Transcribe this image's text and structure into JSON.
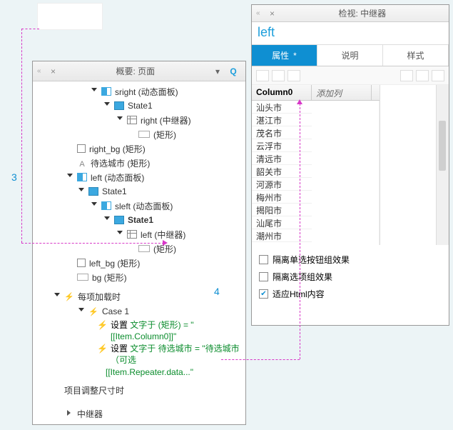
{
  "outline": {
    "title": "概要: 页面",
    "nodes": {
      "sright": "sright (动态面板)",
      "state1a": "State1",
      "right_rep": "right (中继器)",
      "rect1": "(矩形)",
      "right_bg": "right_bg (矩形)",
      "pending_city": "待选城市 (矩形)",
      "left_panel": "left (动态面板)",
      "state1b": "State1",
      "sleft": "sleft (动态面板)",
      "state1c": "State1",
      "left_rep": "left (中继器)",
      "rect2": "(矩形)",
      "left_bg": "left_bg (矩形)",
      "bg": "bg (矩形)"
    },
    "events": {
      "onItemLoad": "每项加载时",
      "case1": "Case 1",
      "action1_prefix": "设置 ",
      "action1_green": "文字于 (矩形) = \"[[Item.Column0]]\"",
      "action2_prefix": "设置 ",
      "action2_green": "文字于 待选城市 = \"待选城市（可选",
      "action2_cont": "[[Item.Repeater.data...\"",
      "sizeAdjust": "项目调整尺寸时"
    },
    "footer": "中继器"
  },
  "inspector": {
    "title": "检视: 中继器",
    "name_value": "left",
    "tabs": {
      "props": "属性",
      "notes": "说明",
      "style": "样式"
    },
    "columns": {
      "col0": "Column0",
      "addcol": "添加列"
    },
    "rows": [
      "汕头市",
      "湛江市",
      "茂名市",
      "云浮市",
      "清远市",
      "韶关市",
      "河源市",
      "梅州市",
      "揭阳市",
      "汕尾市",
      "潮州市"
    ],
    "options": {
      "isolate_radio": "隔离单选按钮组效果",
      "isolate_select": "隔离选项组效果",
      "fit_html": "适应Html内容"
    }
  },
  "annotations": {
    "label3": "3",
    "label4": "4"
  }
}
